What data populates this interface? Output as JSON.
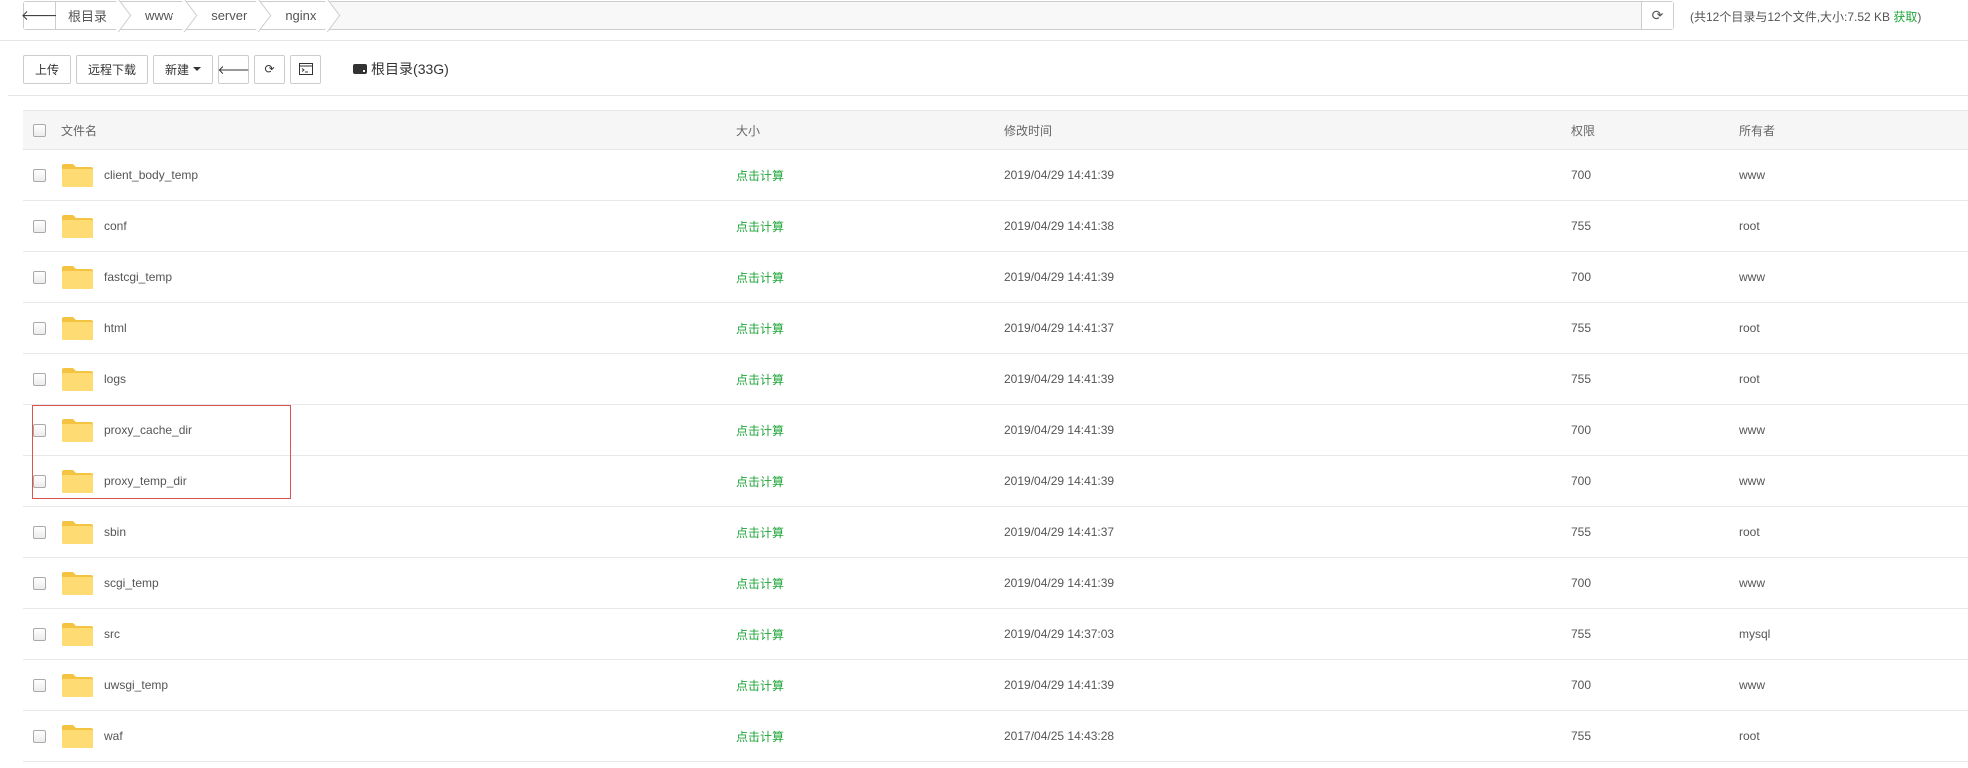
{
  "pathbar": {
    "crumbs": [
      "根目录",
      "www",
      "server",
      "nginx"
    ],
    "stats_text": "(共12个目录与12个文件,大小:7.52 KB ",
    "stats_get": "获取",
    "stats_close": ")"
  },
  "toolbar": {
    "upload": "上传",
    "remote_download": "远程下载",
    "new": "新建",
    "disk_label": "根目录(33G)"
  },
  "table": {
    "headers": {
      "name": "文件名",
      "size": "大小",
      "mtime": "修改时间",
      "perm": "权限",
      "owner": "所有者"
    },
    "rows": [
      {
        "name": "client_body_temp",
        "size": "点击计算",
        "mtime": "2019/04/29 14:41:39",
        "perm": "700",
        "owner": "www"
      },
      {
        "name": "conf",
        "size": "点击计算",
        "mtime": "2019/04/29 14:41:38",
        "perm": "755",
        "owner": "root"
      },
      {
        "name": "fastcgi_temp",
        "size": "点击计算",
        "mtime": "2019/04/29 14:41:39",
        "perm": "700",
        "owner": "www"
      },
      {
        "name": "html",
        "size": "点击计算",
        "mtime": "2019/04/29 14:41:37",
        "perm": "755",
        "owner": "root"
      },
      {
        "name": "logs",
        "size": "点击计算",
        "mtime": "2019/04/29 14:41:39",
        "perm": "755",
        "owner": "root"
      },
      {
        "name": "proxy_cache_dir",
        "size": "点击计算",
        "mtime": "2019/04/29 14:41:39",
        "perm": "700",
        "owner": "www"
      },
      {
        "name": "proxy_temp_dir",
        "size": "点击计算",
        "mtime": "2019/04/29 14:41:39",
        "perm": "700",
        "owner": "www"
      },
      {
        "name": "sbin",
        "size": "点击计算",
        "mtime": "2019/04/29 14:41:37",
        "perm": "755",
        "owner": "root"
      },
      {
        "name": "scgi_temp",
        "size": "点击计算",
        "mtime": "2019/04/29 14:41:39",
        "perm": "700",
        "owner": "www"
      },
      {
        "name": "src",
        "size": "点击计算",
        "mtime": "2019/04/29 14:37:03",
        "perm": "755",
        "owner": "mysql"
      },
      {
        "name": "uwsgi_temp",
        "size": "点击计算",
        "mtime": "2019/04/29 14:41:39",
        "perm": "700",
        "owner": "www"
      },
      {
        "name": "waf",
        "size": "点击计算",
        "mtime": "2017/04/25 14:43:28",
        "perm": "755",
        "owner": "root"
      }
    ]
  },
  "colors": {
    "accent_green": "#20a53a",
    "folder_yellow": "#ffd966",
    "highlight_red": "#d9534f"
  },
  "icons": {
    "back": "arrow-left-icon",
    "refresh": "refresh-icon",
    "terminal": "terminal-icon",
    "disk": "hard-drive-icon",
    "folder": "folder-icon"
  }
}
